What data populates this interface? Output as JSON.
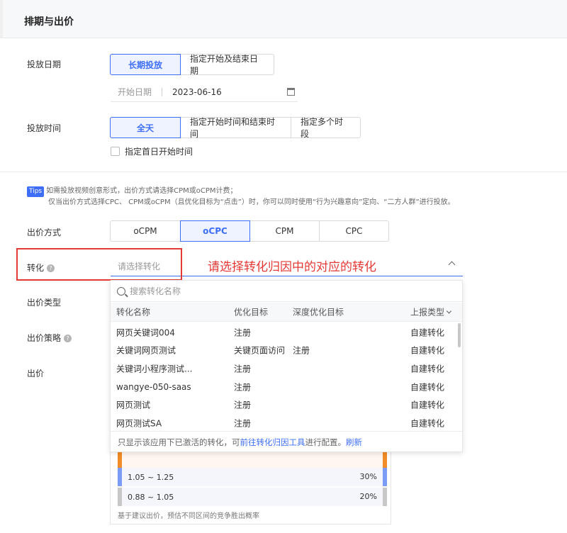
{
  "section": {
    "title": "排期与出价"
  },
  "schedule_date": {
    "label": "投放日期",
    "options": [
      "长期投放",
      "指定开始及结束日期"
    ],
    "start_placeholder": "开始日期",
    "start_value": "2023-06-16"
  },
  "schedule_time": {
    "label": "投放时间",
    "options": [
      "全天",
      "指定开始时间和结束时间",
      "指定多个时段"
    ],
    "first_day_checkbox": "指定首日开始时间"
  },
  "tips": {
    "badge": "Tips",
    "line1": "如需投放视频创意形式，出价方式请选择CPM或oCPM计费；",
    "line2": "仅当出价方式选择CPC、 CPM或oCPM（且优化目标为“点击”）时，你可以同时使用“行为兴趣意向”定向、“二方人群”进行投放。"
  },
  "bid_method": {
    "label": "出价方式",
    "options": [
      "oCPM",
      "oCPC",
      "CPM",
      "CPC"
    ]
  },
  "conversion": {
    "label": "转化",
    "placeholder": "请选择转化",
    "annotation": "请选择转化归因中的对应的转化"
  },
  "dropdown": {
    "search_placeholder": "搜索转化名称",
    "columns": [
      "转化名称",
      "优化目标",
      "深度优化目标",
      "上报类型"
    ],
    "rows": [
      {
        "name": "网页关键词004",
        "goal": "注册",
        "deep_goal": "",
        "type": "自建转化"
      },
      {
        "name": "关键词网页测试",
        "goal": "关键页面访问",
        "deep_goal": "注册",
        "type": "自建转化"
      },
      {
        "name": "关键词小程序测试...",
        "goal": "注册",
        "deep_goal": "",
        "type": "自建转化"
      },
      {
        "name": "wangye-050-saas",
        "goal": "注册",
        "deep_goal": "",
        "type": "自建转化"
      },
      {
        "name": "网页测试",
        "goal": "注册",
        "deep_goal": "",
        "type": "自建转化"
      },
      {
        "name": "网页测试SA",
        "goal": "注册",
        "deep_goal": "",
        "type": "自建转化"
      }
    ],
    "footer_prefix": "只显示该应用下已激活的转化，可",
    "footer_link": "前往转化归因工具",
    "footer_mid": "进行配置。",
    "footer_refresh": "刷新"
  },
  "bid_type": {
    "label": "出价类型"
  },
  "bid_strategy": {
    "label": "出价策略"
  },
  "bid": {
    "label": "出价",
    "ranges": [
      {
        "range": "1.05 ~ 1.25",
        "pct": "30%",
        "color": "#7b9cf5"
      },
      {
        "range": "0.88 ~ 1.05",
        "pct": "20%",
        "color": "#c8c8c8"
      }
    ],
    "note": "基于建议出价，预估不同区间的竞争胜出概率"
  },
  "colors": {
    "accent": "#3d6ef5",
    "annotation": "#e53935",
    "orange": "#f28c28"
  }
}
